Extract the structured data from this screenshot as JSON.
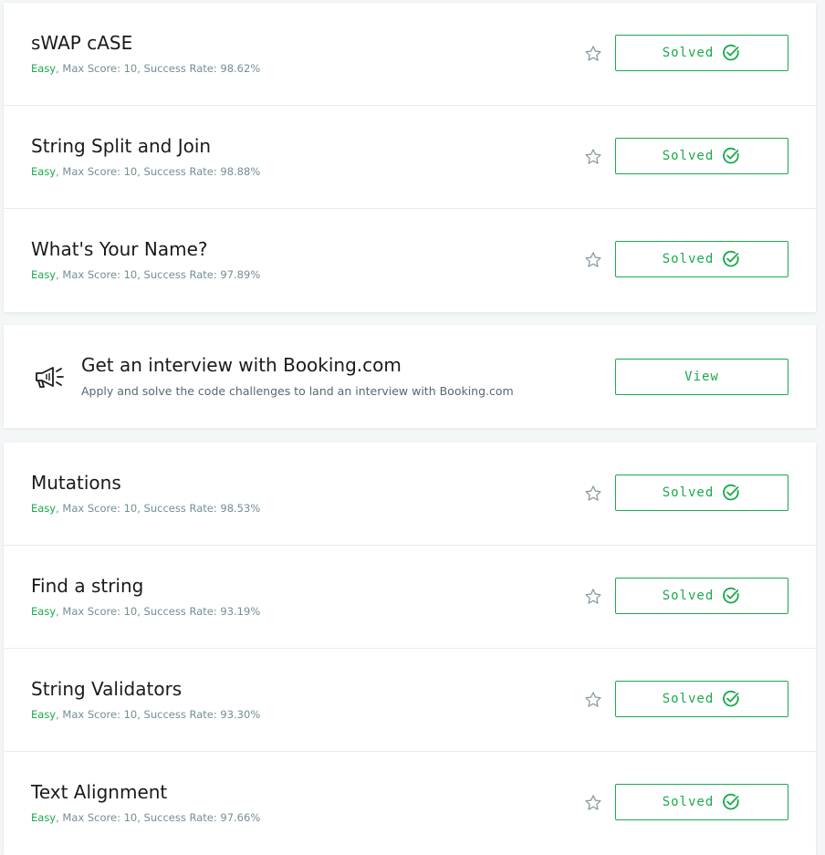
{
  "colors": {
    "accent": "#1ba94c",
    "meta_text": "#738f93",
    "background": "#f3f7f7",
    "star": "#8a9ba3"
  },
  "icons": {
    "star": "star-outline-icon",
    "solved": "check-circle-icon",
    "promo": "megaphone-icon"
  },
  "challenges_top": [
    {
      "title": "sWAP cASE",
      "difficulty": "Easy",
      "meta": ", Max Score: 10, Success Rate: 98.62%",
      "status": "Solved"
    },
    {
      "title": "String Split and Join",
      "difficulty": "Easy",
      "meta": ", Max Score: 10, Success Rate: 98.88%",
      "status": "Solved"
    },
    {
      "title": "What's Your Name?",
      "difficulty": "Easy",
      "meta": ", Max Score: 10, Success Rate: 97.89%",
      "status": "Solved"
    }
  ],
  "promo": {
    "title": "Get an interview with Booking.com",
    "description": "Apply and solve the code challenges to land an interview with Booking.com",
    "button_label": "View"
  },
  "challenges_bottom": [
    {
      "title": "Mutations",
      "difficulty": "Easy",
      "meta": ", Max Score: 10, Success Rate: 98.53%",
      "status": "Solved"
    },
    {
      "title": "Find a string",
      "difficulty": "Easy",
      "meta": ", Max Score: 10, Success Rate: 93.19%",
      "status": "Solved"
    },
    {
      "title": "String Validators",
      "difficulty": "Easy",
      "meta": ", Max Score: 10, Success Rate: 93.30%",
      "status": "Solved"
    },
    {
      "title": "Text Alignment",
      "difficulty": "Easy",
      "meta": ", Max Score: 10, Success Rate: 97.66%",
      "status": "Solved"
    }
  ]
}
